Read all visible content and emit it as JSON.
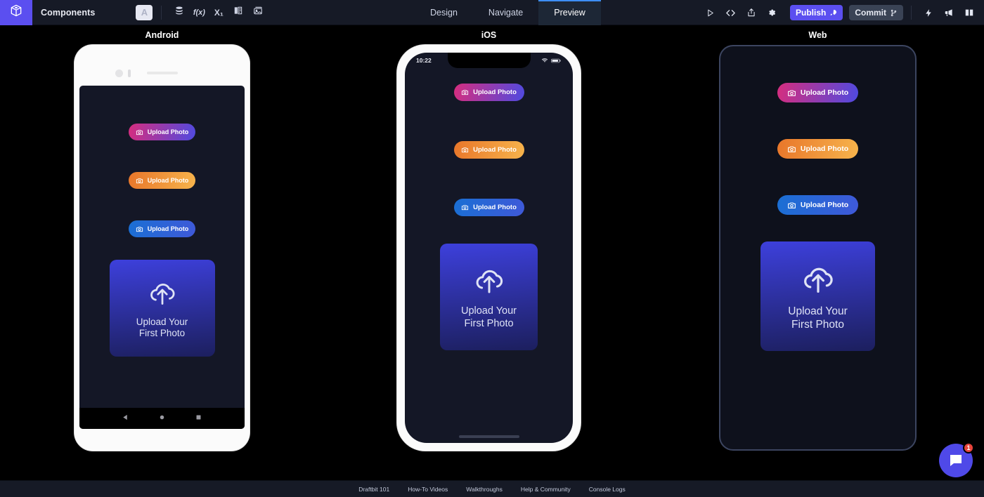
{
  "topbar": {
    "logo_icon": "cube-box-icon",
    "project_label": "Components",
    "tools": [
      {
        "name": "text-tool",
        "glyph": "A"
      },
      {
        "name": "data-stack-icon",
        "glyph": "☰"
      },
      {
        "name": "function-icon",
        "glyph": "f(x)"
      },
      {
        "name": "variable-icon",
        "glyph": "X₁"
      },
      {
        "name": "theme-palette-icon",
        "glyph": "◨"
      },
      {
        "name": "assets-image-icon",
        "glyph": "▣"
      }
    ],
    "tabs": [
      {
        "label": "Design",
        "active": false
      },
      {
        "label": "Navigate",
        "active": false
      },
      {
        "label": "Preview",
        "active": true
      }
    ],
    "right_icons": [
      {
        "name": "play-icon",
        "glyph": "▶"
      },
      {
        "name": "code-icon",
        "glyph": "</>"
      },
      {
        "name": "share-export-icon",
        "glyph": "↱"
      },
      {
        "name": "settings-gear-icon",
        "glyph": "⚙"
      }
    ],
    "publish_label": "Publish",
    "publish_icon": "rocket-icon",
    "commit_label": "Commit",
    "commit_icon": "git-branch-icon",
    "trailing_icons": [
      {
        "name": "lightning-bolt-icon",
        "glyph": "⚡"
      },
      {
        "name": "megaphone-icon",
        "glyph": "📣"
      },
      {
        "name": "book-docs-icon",
        "glyph": "📖"
      }
    ],
    "accent_color": "#5b4ff0",
    "active_tab_underline": "#3d8ff5"
  },
  "panels": [
    {
      "title": "Android"
    },
    {
      "title": "iOS"
    },
    {
      "title": "Web"
    }
  ],
  "android": {
    "status_left": "",
    "status_right": "",
    "nav": [
      {
        "name": "nav-back-icon"
      },
      {
        "name": "nav-home-icon"
      },
      {
        "name": "nav-recents-icon"
      }
    ]
  },
  "ios": {
    "time": "10:22",
    "wifi_icon": "wifi-icon",
    "battery_icon": "battery-icon"
  },
  "app_content": {
    "buttons": [
      {
        "label": "Upload Photo",
        "icon": "camera-icon",
        "gradient_from": "#d62d7e",
        "gradient_to": "#4f4ae0"
      },
      {
        "label": "Upload Photo",
        "icon": "camera-icon",
        "gradient_from": "#e8762a",
        "gradient_to": "#f7b44c"
      },
      {
        "label": "Upload Photo",
        "icon": "camera-icon",
        "gradient_from": "#1a6fd4",
        "gradient_to": "#3f59d8"
      }
    ],
    "card": {
      "icon": "cloud-upload-icon",
      "line1": "Upload Your",
      "line2": "First Photo",
      "gradient_from": "#3d40dc",
      "gradient_to": "#1c1f5e"
    }
  },
  "footer": {
    "links": [
      "Draftbit 101",
      "How-To Videos",
      "Walkthroughs",
      "Help & Community",
      "Console Logs"
    ]
  },
  "chat": {
    "icon": "chat-bubble-icon",
    "badge_count": "1",
    "color": "#4f49e8",
    "badge_color": "#e8453c"
  }
}
